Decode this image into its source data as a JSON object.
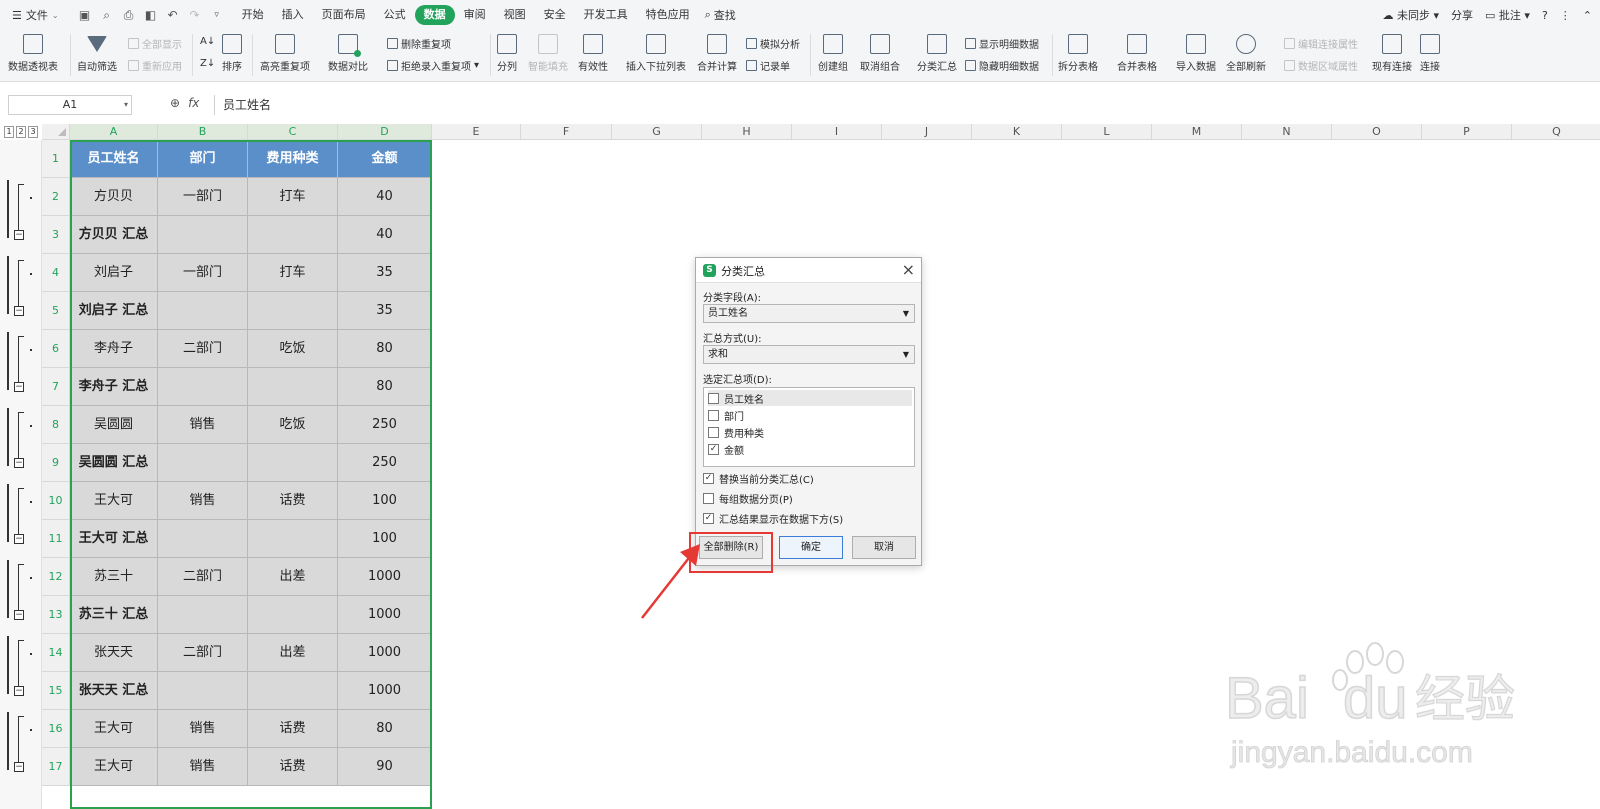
{
  "menubar": {
    "file": "文件",
    "tabs": [
      "开始",
      "插入",
      "页面布局",
      "公式",
      "数据",
      "审阅",
      "视图",
      "安全",
      "开发工具",
      "特色应用"
    ],
    "active_tab": 4,
    "search": "查找",
    "right": {
      "sync": "未同步",
      "share": "分享",
      "comment": "批注",
      "help": "?"
    }
  },
  "ribbon": {
    "pivot": "数据透视表",
    "autofilter": "自动筛选",
    "show_all": "全部显示",
    "reapply": "重新应用",
    "sort": "排序",
    "highlight_dup": "高亮重复项",
    "compare": "数据对比",
    "delete_dup": "删除重复项",
    "reject_dup": "拒绝录入重复项",
    "split": "分列",
    "smart_fill": "智能填充",
    "validity": "有效性",
    "dropdown": "插入下拉列表",
    "consolidate": "合并计算",
    "whatif": "模拟分析",
    "record": "记录单",
    "group": "创建组",
    "ungroup": "取消组合",
    "subtotal": "分类汇总",
    "show_detail": "显示明细数据",
    "hide_detail": "隐藏明细数据",
    "split_table": "拆分表格",
    "merge_table": "合并表格",
    "import": "导入数据",
    "refresh_all": "全部刷新",
    "edit_conn": "编辑连接属性",
    "range_prop": "数据区域属性",
    "existing_conn": "现有连接",
    "connect": "连接"
  },
  "formula_bar": {
    "name_box": "A1",
    "fx": "fx",
    "content": "员工姓名"
  },
  "grid": {
    "columns": [
      "A",
      "B",
      "C",
      "D",
      "E",
      "F",
      "G",
      "H",
      "I",
      "J",
      "K",
      "L",
      "M",
      "N",
      "O",
      "P",
      "Q"
    ],
    "outline_levels": [
      "1",
      "2",
      "3"
    ],
    "header": [
      "员工姓名",
      "部门",
      "费用种类",
      "金额"
    ],
    "rows": [
      {
        "n": "1"
      },
      {
        "n": "2",
        "a": "方贝贝",
        "b": "一部门",
        "c": "打车",
        "d": "40"
      },
      {
        "n": "3",
        "a": "方贝贝 汇总",
        "b": "",
        "c": "",
        "d": "40"
      },
      {
        "n": "4",
        "a": "刘启子",
        "b": "一部门",
        "c": "打车",
        "d": "35"
      },
      {
        "n": "5",
        "a": "刘启子 汇总",
        "b": "",
        "c": "",
        "d": "35"
      },
      {
        "n": "6",
        "a": "李舟子",
        "b": "二部门",
        "c": "吃饭",
        "d": "80"
      },
      {
        "n": "7",
        "a": "李舟子 汇总",
        "b": "",
        "c": "",
        "d": "80"
      },
      {
        "n": "8",
        "a": "吴圆圆",
        "b": "销售",
        "c": "吃饭",
        "d": "250"
      },
      {
        "n": "9",
        "a": "吴圆圆 汇总",
        "b": "",
        "c": "",
        "d": "250"
      },
      {
        "n": "10",
        "a": "王大可",
        "b": "销售",
        "c": "话费",
        "d": "100"
      },
      {
        "n": "11",
        "a": "王大可 汇总",
        "b": "",
        "c": "",
        "d": "100"
      },
      {
        "n": "12",
        "a": "苏三十",
        "b": "二部门",
        "c": "出差",
        "d": "1000"
      },
      {
        "n": "13",
        "a": "苏三十 汇总",
        "b": "",
        "c": "",
        "d": "1000"
      },
      {
        "n": "14",
        "a": "张天天",
        "b": "二部门",
        "c": "出差",
        "d": "1000"
      },
      {
        "n": "15",
        "a": "张天天 汇总",
        "b": "",
        "c": "",
        "d": "1000"
      },
      {
        "n": "16",
        "a": "王大可",
        "b": "销售",
        "c": "话费",
        "d": "80"
      },
      {
        "n": "17",
        "a": "王大可",
        "b": "销售",
        "c": "话费",
        "d": "90"
      }
    ]
  },
  "dialog": {
    "title": "分类汇总",
    "field_label": "分类字段(A):",
    "field_value": "员工姓名",
    "method_label": "汇总方式(U):",
    "method_value": "求和",
    "items_label": "选定汇总项(D):",
    "items": [
      {
        "label": "员工姓名",
        "checked": false
      },
      {
        "label": "部门",
        "checked": false
      },
      {
        "label": "费用种类",
        "checked": false
      },
      {
        "label": "金额",
        "checked": true
      }
    ],
    "options": [
      {
        "label": "替换当前分类汇总(C)",
        "checked": true
      },
      {
        "label": "每组数据分页(P)",
        "checked": false
      },
      {
        "label": "汇总结果显示在数据下方(S)",
        "checked": true
      }
    ],
    "remove_all": "全部删除(R)",
    "ok": "确定",
    "cancel": "取消"
  },
  "watermark": {
    "brand": "Bai",
    "brand2": "du",
    "cn": "经验",
    "url": "jingyan.baidu.com"
  },
  "colors": {
    "accent": "#21a35b",
    "header_fill": "#5b8fc9",
    "highlight": "#e53935"
  }
}
